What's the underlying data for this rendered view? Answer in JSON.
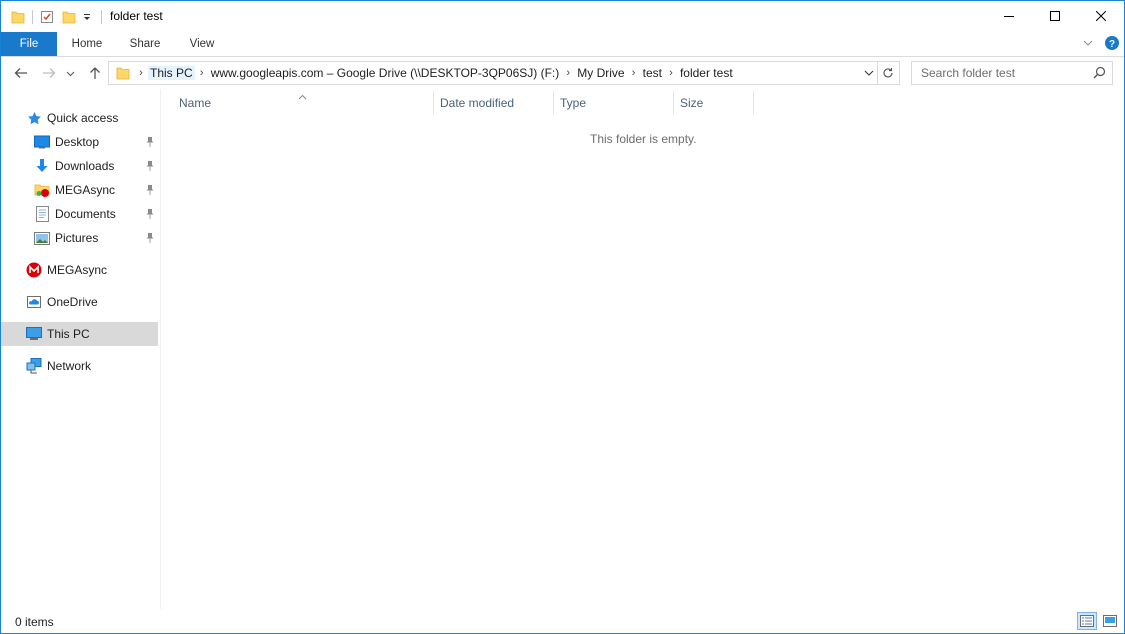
{
  "window": {
    "title": "folder test"
  },
  "quick_access_toolbar": {
    "icons": [
      "folder-icon",
      "properties-icon",
      "new-folder-icon",
      "customize-dropdown-icon"
    ]
  },
  "ribbon": {
    "tabs": [
      {
        "label": "File"
      },
      {
        "label": "Home"
      },
      {
        "label": "Share"
      },
      {
        "label": "View"
      }
    ]
  },
  "address_bar": {
    "crumbs": [
      "This PC",
      "www.googleapis.com – Google Drive (\\\\DESKTOP-3QP06SJ) (F:)",
      "My Drive",
      "test",
      "folder test"
    ]
  },
  "search": {
    "placeholder": "Search folder test"
  },
  "sidebar": {
    "quick_access": {
      "label": "Quick access"
    },
    "pinned": [
      {
        "label": "Desktop",
        "icon": "desktop-icon"
      },
      {
        "label": "Downloads",
        "icon": "downloads-icon"
      },
      {
        "label": "MEGAsync",
        "icon": "megasync-folder-icon"
      },
      {
        "label": "Documents",
        "icon": "documents-icon"
      },
      {
        "label": "Pictures",
        "icon": "pictures-icon"
      }
    ],
    "roots": [
      {
        "label": "MEGAsync",
        "icon": "mega-icon"
      },
      {
        "label": "OneDrive",
        "icon": "onedrive-icon"
      },
      {
        "label": "This PC",
        "icon": "this-pc-icon",
        "selected": true
      },
      {
        "label": "Network",
        "icon": "network-icon"
      }
    ]
  },
  "columns": [
    "Name",
    "Date modified",
    "Type",
    "Size"
  ],
  "empty_message": "This folder is empty.",
  "status": {
    "items": "0 items"
  },
  "colors": {
    "accent": "#1979ca",
    "selected_bg": "#d9d9d9",
    "header_text": "#4c607a"
  }
}
